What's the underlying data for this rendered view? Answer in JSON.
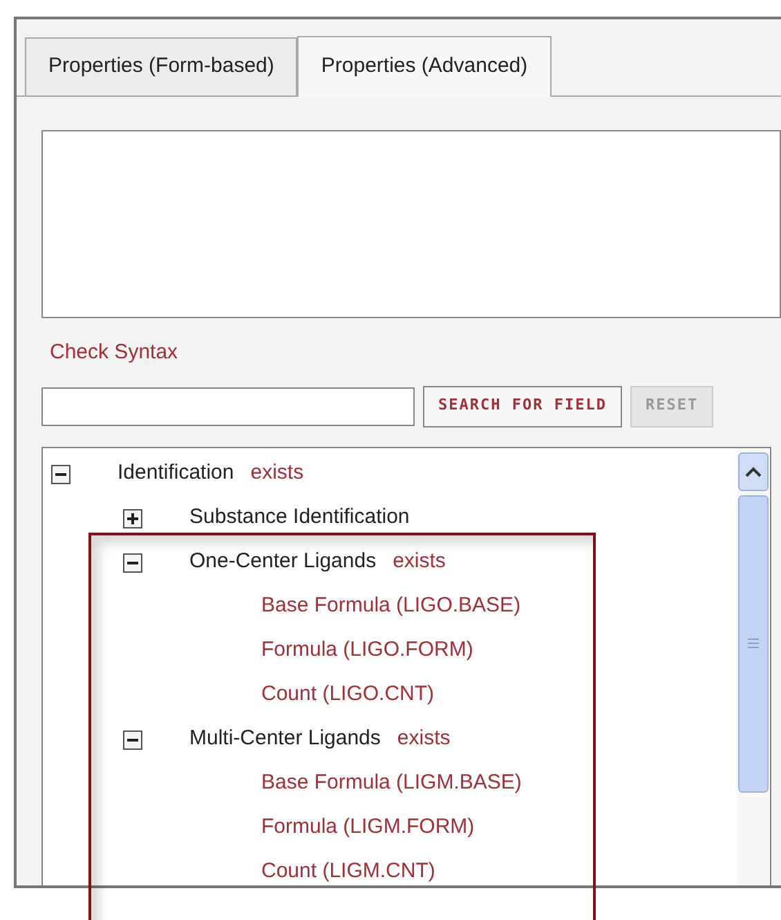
{
  "tabs": [
    {
      "label": "Properties (Form-based)",
      "selected": false
    },
    {
      "label": "Properties (Advanced)",
      "selected": true
    }
  ],
  "check_syntax": "Check Syntax",
  "search": {
    "button": "SEARCH FOR FIELD",
    "reset": "RESET",
    "reset_disabled": true
  },
  "tree": [
    {
      "kind": "group",
      "label": "Identification",
      "status": "exists",
      "expanded": true,
      "children": [
        {
          "kind": "group",
          "label": "Substance Identification",
          "expanded": false
        },
        {
          "kind": "group",
          "label": "One-Center Ligands",
          "status": "exists",
          "expanded": true,
          "children": [
            {
              "kind": "field",
              "label": "Base Formula (LIGO.BASE)"
            },
            {
              "kind": "field",
              "label": "Formula (LIGO.FORM)"
            },
            {
              "kind": "field",
              "label": "Count (LIGO.CNT)"
            }
          ]
        },
        {
          "kind": "group",
          "label": "Multi-Center Ligands",
          "status": "exists",
          "expanded": true,
          "children": [
            {
              "kind": "field",
              "label": "Base Formula (LIGM.BASE)"
            },
            {
              "kind": "field",
              "label": "Formula (LIGM.FORM)"
            },
            {
              "kind": "field",
              "label": "Count (LIGM.CNT)"
            }
          ]
        }
      ]
    }
  ]
}
